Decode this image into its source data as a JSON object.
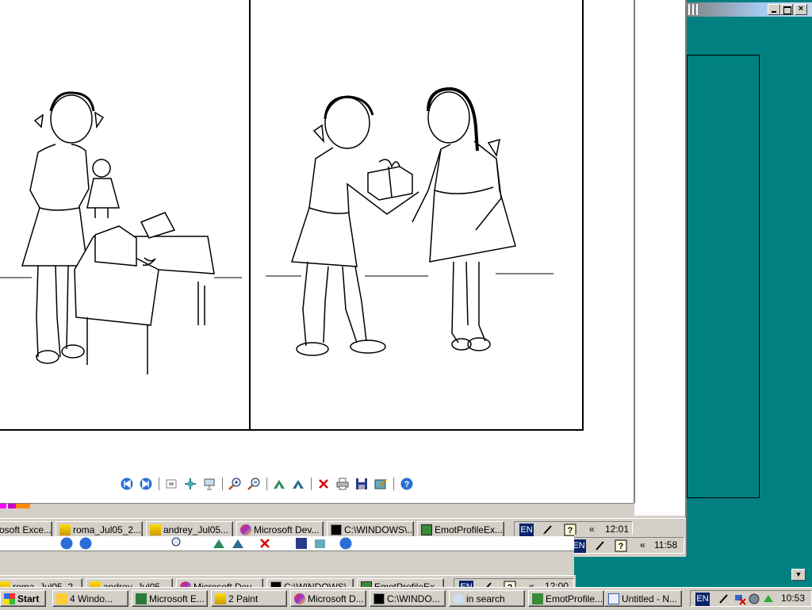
{
  "background_window": {
    "title_controls": [
      "minimize",
      "maximize",
      "close"
    ]
  },
  "viewer": {
    "toolbar_icons": [
      "previous-image-icon",
      "next-image-icon",
      "best-fit-icon",
      "actual-size-icon",
      "slideshow-icon",
      "zoom-in-icon",
      "zoom-out-icon",
      "rotate-clockwise-icon",
      "rotate-counterclockwise-icon",
      "delete-icon",
      "print-icon",
      "save-icon",
      "open-editor-icon",
      "help-icon"
    ]
  },
  "taskbar_1": {
    "buttons": [
      {
        "label": "osoft Exce..."
      },
      {
        "label": "roma_Jul05_2..."
      },
      {
        "label": "andrey_Jul05..."
      },
      {
        "label": "Microsoft Dev..."
      },
      {
        "label": "C:\\WINDOWS\\..."
      },
      {
        "label": "EmotProfileEx..."
      }
    ],
    "lang": "EN",
    "chevron": "«",
    "clock": "12:01"
  },
  "taskbar_2": {
    "lang": "EN",
    "chevron": "«",
    "clock": "11:58"
  },
  "taskbar_3": {
    "buttons": [
      {
        "label": "roma_Jul05_2..."
      },
      {
        "label": "andrey_Jul05..."
      },
      {
        "label": "Microsoft Dev..."
      },
      {
        "label": "C:\\WINDOWS\\..."
      },
      {
        "label": "EmotProfileEx..."
      }
    ],
    "lang": "EN",
    "chevron": "«",
    "clock": "12:00"
  },
  "taskbar_main": {
    "start_label": "Start",
    "buttons": [
      {
        "label": "4 Windo..."
      },
      {
        "label": "Microsoft E..."
      },
      {
        "label": "2 Paint"
      },
      {
        "label": "Microsoft D..."
      },
      {
        "label": "C:\\WINDO..."
      },
      {
        "label": "in search"
      },
      {
        "label": "EmotProfile..."
      },
      {
        "label": "Untitled - N..."
      }
    ],
    "lang": "EN",
    "clock": "10:53"
  },
  "colors": {
    "desktop": "#008080",
    "titlebar_active": "#0a246a",
    "titlebar_inactive": "#a6caf0",
    "face": "#d4d0c8"
  }
}
